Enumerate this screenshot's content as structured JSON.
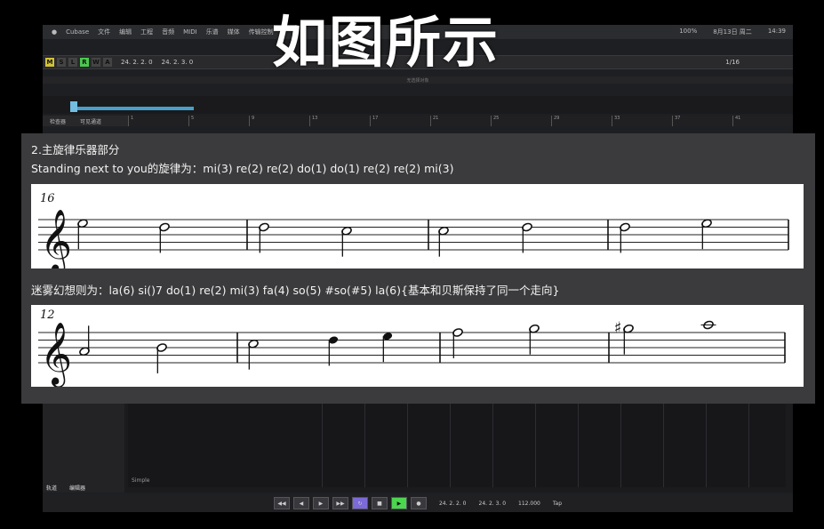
{
  "overlay": {
    "title": "如图所示"
  },
  "daw": {
    "menubar": {
      "app_name": "Cubase",
      "menus": [
        "文件",
        "编辑",
        "工程",
        "音频",
        "MIDI",
        "乐谱",
        "媒体",
        "传输控制",
        "工作室",
        "工作区",
        "窗口",
        "帮助"
      ],
      "right_items": [
        "100%",
        "8月13日 周二",
        "14:39"
      ]
    },
    "toolbar": {
      "buttons": [
        "M",
        "S",
        "L",
        "R",
        "W",
        "A"
      ],
      "position_left": "24. 2. 2. 0",
      "position_right": "24. 2. 3. 0",
      "page": "1/16"
    },
    "subbar_text": "无选择对象",
    "tabs": [
      "检查器",
      "可见通道"
    ],
    "timeline_ticks": [
      "1",
      "5",
      "9",
      "13",
      "17",
      "21",
      "25",
      "29",
      "33",
      "37",
      "41",
      "45"
    ],
    "lower_tabs": [
      "轨道",
      "编辑器"
    ],
    "lower_label": "Simple",
    "transport": {
      "left_position": "24. 2. 2. 0",
      "right_position": "24. 2. 3. 0",
      "tempo": "112.000",
      "tap_label": "Tap"
    }
  },
  "panel": {
    "heading": "2.主旋律乐器部分",
    "line1": "Standing next to you的旋律为：mi(3) re(2) re(2) do(1) do(1) re(2) re(2) mi(3)",
    "score1": {
      "measure_number": "16",
      "clef": "treble",
      "notes": [
        {
          "measure": 1,
          "pitch": "E5",
          "duration": "half"
        },
        {
          "measure": 1,
          "pitch": "D5",
          "duration": "half"
        },
        {
          "measure": 2,
          "pitch": "D5",
          "duration": "half"
        },
        {
          "measure": 2,
          "pitch": "C5",
          "duration": "half"
        },
        {
          "measure": 3,
          "pitch": "C5",
          "duration": "half"
        },
        {
          "measure": 3,
          "pitch": "D5",
          "duration": "half"
        },
        {
          "measure": 4,
          "pitch": "D5",
          "duration": "half"
        },
        {
          "measure": 4,
          "pitch": "E5",
          "duration": "half"
        }
      ]
    },
    "line2": "迷雾幻想则为：la(6) si()7 do(1) re(2) mi(3) fa(4) so(5) #so(#5) la(6){基本和贝斯保持了同一个走向}",
    "score2": {
      "measure_number": "12",
      "clef": "treble",
      "notes": [
        {
          "measure": 1,
          "pitch": "A4",
          "duration": "half"
        },
        {
          "measure": 1,
          "pitch": "B4",
          "duration": "half"
        },
        {
          "measure": 2,
          "pitch": "C5",
          "duration": "half"
        },
        {
          "measure": 2,
          "pitch": "D5",
          "duration": "quarter"
        },
        {
          "measure": 2,
          "pitch": "E5",
          "duration": "quarter"
        },
        {
          "measure": 3,
          "pitch": "F5",
          "duration": "half"
        },
        {
          "measure": 3,
          "pitch": "G5",
          "duration": "half"
        },
        {
          "measure": 4,
          "pitch": "G#5",
          "duration": "half"
        },
        {
          "measure": 4,
          "pitch": "A5",
          "duration": "whole"
        }
      ]
    }
  }
}
